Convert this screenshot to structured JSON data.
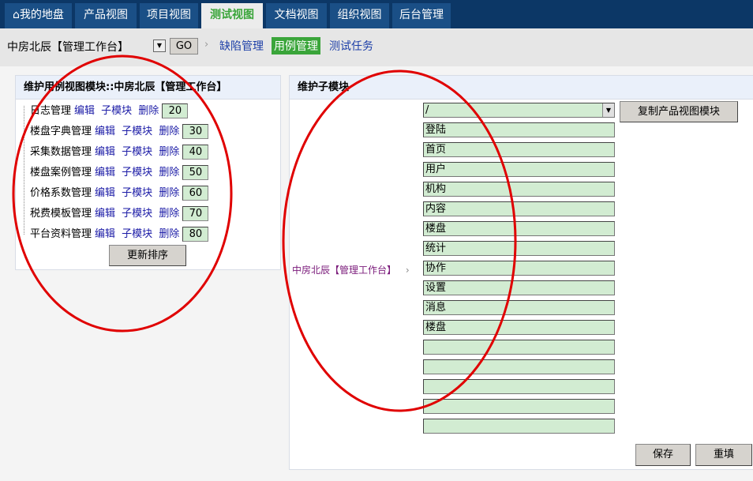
{
  "nav": {
    "tabs": [
      {
        "label": "我的地盘",
        "icon": "home-icon"
      },
      {
        "label": "产品视图"
      },
      {
        "label": "项目视图"
      },
      {
        "label": "测试视图",
        "active": true
      },
      {
        "label": "文档视图"
      },
      {
        "label": "组织视图"
      },
      {
        "label": "后台管理"
      }
    ]
  },
  "subnav": {
    "project": "中房北辰【管理工作台】",
    "go": "GO",
    "links": [
      "缺陷管理",
      "用例管理",
      "测试任务"
    ],
    "active": "用例管理"
  },
  "left": {
    "title": "维护用例视图模块::中房北辰【管理工作台】",
    "edit": "编辑",
    "submodule": "子模块",
    "delete": "删除",
    "items": [
      {
        "name": "日志管理",
        "order": "20"
      },
      {
        "name": "楼盘字典管理",
        "order": "30"
      },
      {
        "name": "采集数据管理",
        "order": "40"
      },
      {
        "name": "楼盘案例管理",
        "order": "50"
      },
      {
        "name": "价格系数管理",
        "order": "60"
      },
      {
        "name": "税费模板管理",
        "order": "70"
      },
      {
        "name": "平台资料管理",
        "order": "80"
      }
    ],
    "update": "更新排序"
  },
  "right": {
    "title": "维护子模块",
    "parent": "中房北辰【管理工作台】",
    "sep": "›",
    "select": "/",
    "copy": "复制产品视图模块",
    "modules": [
      "登陆",
      "首页",
      "用户",
      "机构",
      "内容",
      "楼盘",
      "统计",
      "协作",
      "设置",
      "消息",
      "楼盘",
      "",
      "",
      "",
      "",
      ""
    ],
    "save": "保存",
    "reset": "重填"
  },
  "colors": {
    "nav": "#0c3766",
    "active": "#3aa53a",
    "annotation": "#e00000"
  }
}
